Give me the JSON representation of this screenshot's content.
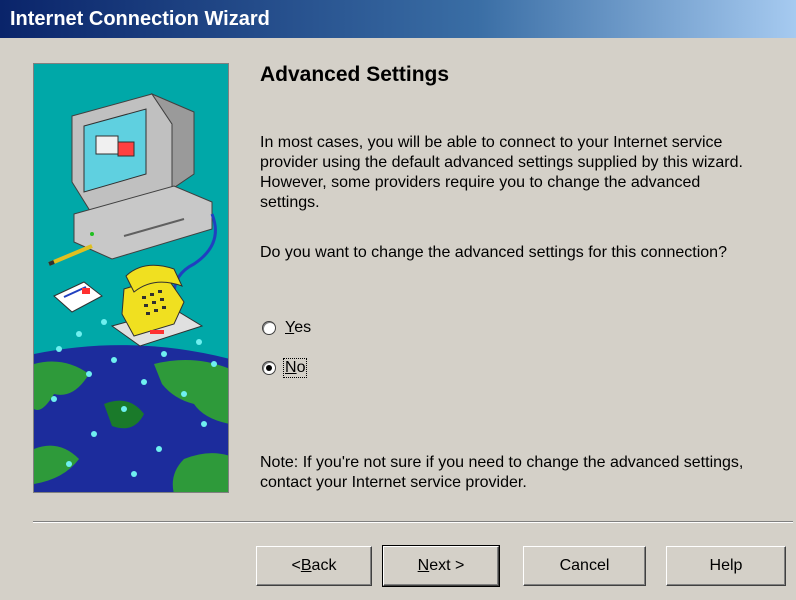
{
  "window": {
    "title": "Internet Connection Wizard"
  },
  "page": {
    "heading": "Advanced Settings",
    "intro": "In most cases, you will be able to connect to your Internet service provider using the default advanced settings supplied by this wizard.  However, some providers require you to change the advanced settings.",
    "question": "Do you want to change the advanced settings for this connection?",
    "note": "Note: If you're not sure if you need to change the advanced settings, contact your Internet service provider."
  },
  "options": {
    "yes": {
      "prefix": "",
      "mnemonic": "Y",
      "suffix": "es",
      "selected": false
    },
    "no": {
      "prefix": "",
      "mnemonic": "N",
      "suffix": "o",
      "selected": true
    }
  },
  "buttons": {
    "back": {
      "prefix": "< ",
      "mnemonic": "B",
      "suffix": "ack"
    },
    "next": {
      "prefix": "",
      "mnemonic": "N",
      "suffix": "ext >"
    },
    "cancel": "Cancel",
    "help": "Help"
  },
  "colors": {
    "titlebar_start": "#0a246a",
    "titlebar_end": "#a6caf0",
    "dialog_face": "#d4d0c8",
    "art_teal": "#00a8a8",
    "art_ocean": "#1c2c9c",
    "art_land": "#2e9a3a"
  },
  "illustration": {
    "icons": [
      "computer-icon",
      "telephone-icon",
      "letter-icon",
      "pencil-icon",
      "globe-icon"
    ]
  }
}
